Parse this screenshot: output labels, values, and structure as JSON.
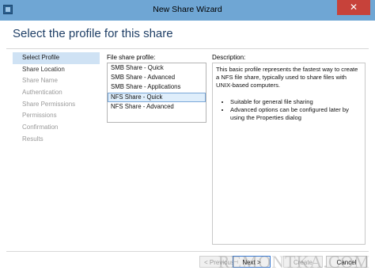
{
  "window": {
    "title": "New Share Wizard",
    "close_glyph": "✕"
  },
  "page": {
    "title": "Select the profile for this share"
  },
  "nav": {
    "items": [
      {
        "label": "Select Profile",
        "state": "active"
      },
      {
        "label": "Share Location",
        "state": "normal"
      },
      {
        "label": "Share Name",
        "state": "disabled"
      },
      {
        "label": "Authentication",
        "state": "disabled"
      },
      {
        "label": "Share Permissions",
        "state": "disabled"
      },
      {
        "label": "Permissions",
        "state": "disabled"
      },
      {
        "label": "Confirmation",
        "state": "disabled"
      },
      {
        "label": "Results",
        "state": "disabled"
      }
    ]
  },
  "profiles": {
    "label": "File share profile:",
    "items": [
      "SMB Share - Quick",
      "SMB Share - Advanced",
      "SMB Share - Applications",
      "NFS Share - Quick",
      "NFS Share - Advanced"
    ],
    "selected_index": 3
  },
  "description": {
    "label": "Description:",
    "text": "This basic profile represents the fastest way to create a NFS file share, typically used to share files with UNIX-based computers.",
    "bullets": [
      "Suitable for general file sharing",
      "Advanced options can be configured later by using the Properties dialog"
    ]
  },
  "buttons": {
    "previous": "< Previous",
    "next": "Next >",
    "create": "Create",
    "cancel": "Cancel"
  },
  "watermark": "REMONTKA.COM",
  "colors": {
    "titlebar": "#6fa6d4",
    "close": "#c7423a",
    "heading": "#1f3f66",
    "nav_active": "#cfe2f4",
    "list_selected": "#dfeefb"
  }
}
